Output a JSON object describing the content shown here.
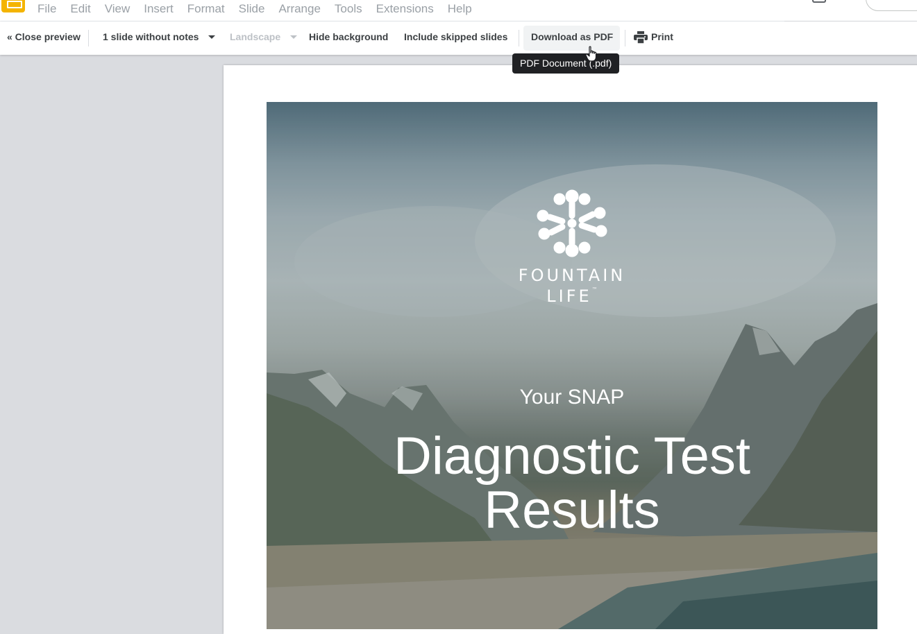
{
  "menubar": {
    "items": [
      "File",
      "Edit",
      "View",
      "Insert",
      "Format",
      "Slide",
      "Arrange",
      "Tools",
      "Extensions",
      "Help"
    ]
  },
  "toolbar": {
    "close_preview": "« Close preview",
    "slides_option": "1 slide without notes",
    "orientation": "Landscape",
    "hide_background": "Hide background",
    "include_skipped": "Include skipped slides",
    "download_pdf": "Download as PDF",
    "print": "Print"
  },
  "tooltip": {
    "text": "PDF Document (.pdf)"
  },
  "slide": {
    "brand_line1": "FOUNTAIN",
    "brand_line2": "LIFE",
    "trademark": "™",
    "subtitle": "Your SNAP",
    "title_line1": "Diagnostic Test",
    "title_line2": "Results"
  },
  "colors": {
    "app_accent": "#f4b400",
    "tooltip_bg": "#202124",
    "canvas_bg": "#dadce0"
  },
  "icons": [
    "slides-app-icon",
    "caret-down-icon",
    "printer-icon",
    "hand-cursor-icon",
    "fountain-life-logo"
  ]
}
